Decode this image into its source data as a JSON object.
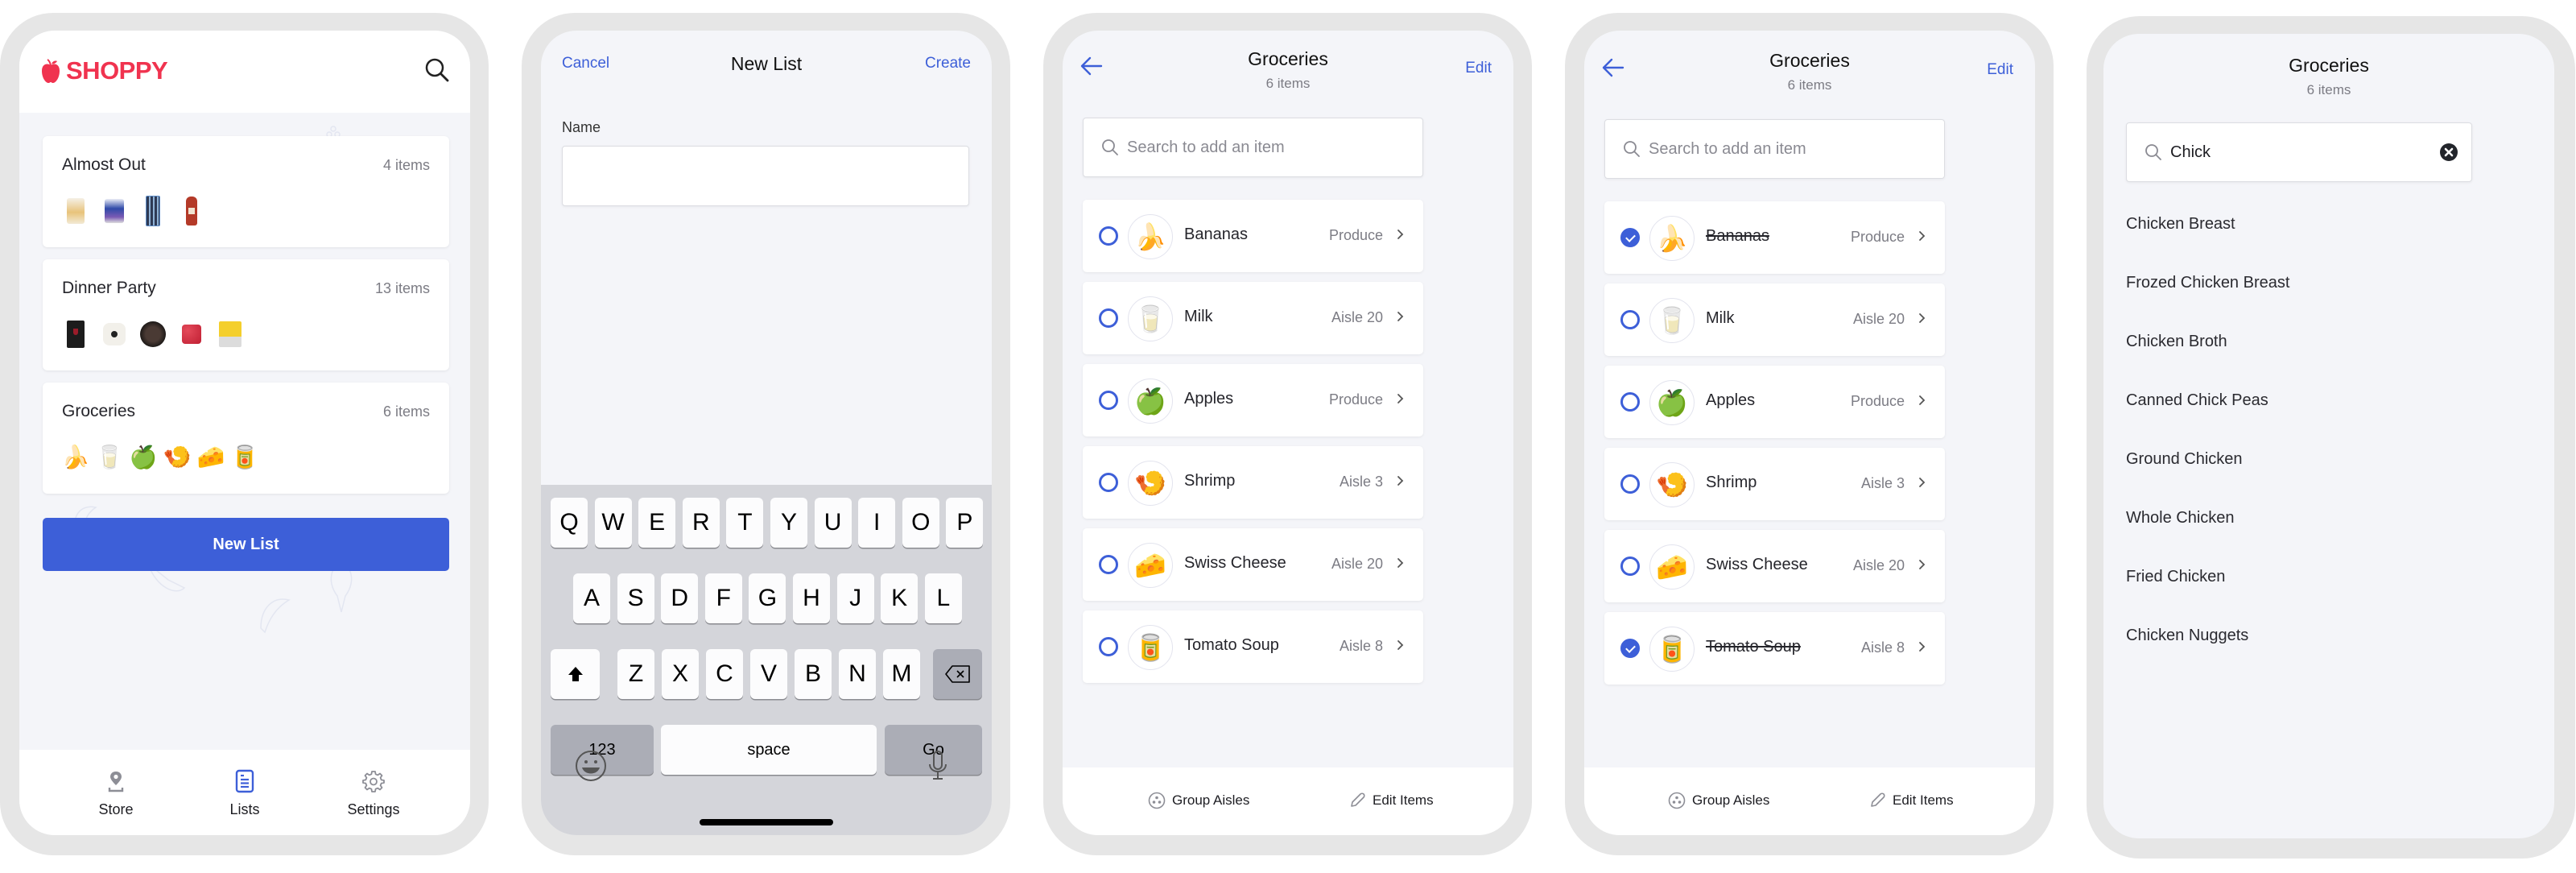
{
  "colors": {
    "brand_red": "#f0334f",
    "accent_blue": "#3d5fd8",
    "screen_bg": "#f4f5f9",
    "frame": "#e6e6e6"
  },
  "home": {
    "logo_text": "SHOPPY",
    "lists": [
      {
        "title": "Almost Out",
        "count": "4 items",
        "thumbs": [
          "bag-of-chips",
          "paper-towels",
          "pens",
          "ketchup-bottle"
        ]
      },
      {
        "title": "Dinner Party",
        "count": "13 items",
        "thumbs": [
          "wine-glasses",
          "plates",
          "dessert-tray",
          "raspberries",
          "cheese-pack"
        ]
      },
      {
        "title": "Groceries",
        "count": "6 items",
        "thumbs": [
          "bananas",
          "milk",
          "apples",
          "shrimp",
          "swiss-cheese",
          "tomato-soup"
        ]
      }
    ],
    "new_list_button": "New List",
    "tabs": [
      {
        "label": "Store",
        "icon": "location-pin-icon",
        "active": false
      },
      {
        "label": "Lists",
        "icon": "list-document-icon",
        "active": true
      },
      {
        "label": "Settings",
        "icon": "gear-icon",
        "active": false
      }
    ]
  },
  "new_list": {
    "cancel": "Cancel",
    "title": "New List",
    "create": "Create",
    "name_label": "Name",
    "name_value": "",
    "keyboard": {
      "row1": [
        "Q",
        "W",
        "E",
        "R",
        "T",
        "Y",
        "U",
        "I",
        "O",
        "P"
      ],
      "row2": [
        "A",
        "S",
        "D",
        "F",
        "G",
        "H",
        "J",
        "K",
        "L"
      ],
      "row3": [
        "Z",
        "X",
        "C",
        "V",
        "B",
        "N",
        "M"
      ],
      "numbers_key": "123",
      "space_key": "space",
      "go_key": "Go"
    }
  },
  "groceries": {
    "title": "Groceries",
    "subtitle": "6 items",
    "edit": "Edit",
    "search_placeholder": "Search to add an item",
    "items": [
      {
        "name": "Bananas",
        "location": "Produce",
        "emoji": "🍌"
      },
      {
        "name": "Milk",
        "location": "Aisle 20",
        "emoji": "🥛"
      },
      {
        "name": "Apples",
        "location": "Produce",
        "emoji": "🍏"
      },
      {
        "name": "Shrimp",
        "location": "Aisle 3",
        "emoji": "🍤"
      },
      {
        "name": "Swiss Cheese",
        "location": "Aisle 20",
        "emoji": "🧀"
      },
      {
        "name": "Tomato Soup",
        "location": "Aisle 8",
        "emoji": "🥫"
      }
    ],
    "checked_state_screen3": [
      false,
      false,
      false,
      false,
      false,
      false
    ],
    "checked_state_screen4": [
      true,
      false,
      false,
      false,
      false,
      true
    ],
    "group_aisles": "Group Aisles",
    "edit_items": "Edit Items"
  },
  "search": {
    "title": "Groceries",
    "subtitle": "6 items",
    "query": "Chick",
    "results": [
      "Chicken Breast",
      "Frozed Chicken Breast",
      "Chicken Broth",
      "Canned Chick Peas",
      "Ground Chicken",
      "Whole Chicken",
      "Fried Chicken",
      "Chicken Nuggets"
    ]
  }
}
